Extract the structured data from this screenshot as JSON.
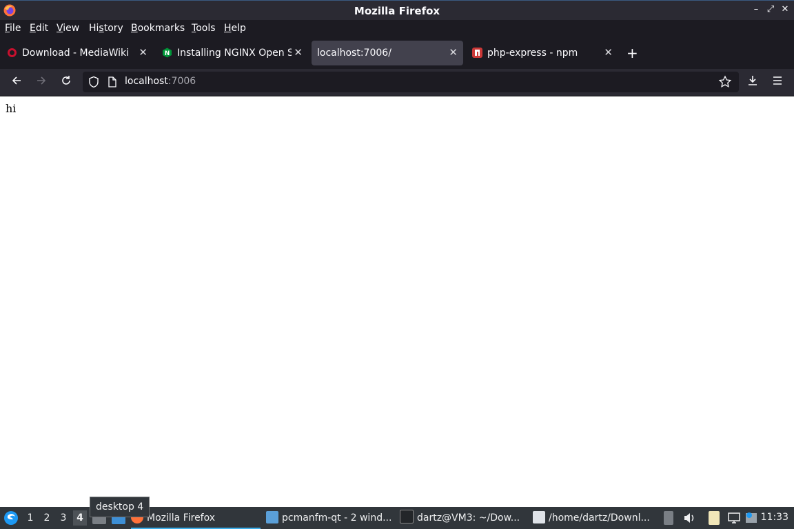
{
  "window": {
    "title": "Mozilla Firefox"
  },
  "menu": [
    {
      "label": "File",
      "underline": "F",
      "rest": "ile"
    },
    {
      "label": "Edit",
      "underline": "E",
      "rest": "dit"
    },
    {
      "label": "View",
      "underline": "V",
      "rest": "iew"
    },
    {
      "label": "History",
      "pre": "Hi",
      "underline": "s",
      "rest": "tory"
    },
    {
      "label": "Bookmarks",
      "underline": "B",
      "rest": "ookmarks"
    },
    {
      "label": "Tools",
      "underline": "T",
      "rest": "ools"
    },
    {
      "label": "Help",
      "underline": "H",
      "rest": "elp"
    }
  ],
  "tabs": [
    {
      "label": "Download - MediaWiki",
      "icon": "mediawiki-icon",
      "color": "#c8102e",
      "active": false
    },
    {
      "label": "Installing NGINX Open Sc",
      "icon": "nginx-icon",
      "color": "#009639",
      "active": false
    },
    {
      "label": "localhost:7006/",
      "icon": "",
      "color": "",
      "active": true
    },
    {
      "label": "php-express - npm",
      "icon": "npm-icon",
      "color": "#cb3837",
      "active": false
    }
  ],
  "urlbar": {
    "host_main": "localhost",
    "host_port": ":7006"
  },
  "page": {
    "text": "hi"
  },
  "tooltip": "desktop 4",
  "taskbar": {
    "desktops": [
      "1",
      "2",
      "3",
      "4"
    ],
    "active_desktop": "4",
    "tasks": [
      {
        "label": "Mozilla Firefox",
        "icon": "firefox-icon",
        "active": true
      },
      {
        "label": "pcmanfm-qt - 2 wind...",
        "icon": "folder-icon",
        "active": false
      },
      {
        "label": "dartz@VM3: ~/Dow...",
        "icon": "terminal-icon",
        "active": false
      },
      {
        "label": "/home/dartz/Downl...",
        "icon": "editor-icon",
        "active": false
      }
    ],
    "clock": "11:33"
  },
  "colors": {
    "accent": "#3daee9",
    "ff_orange": "#ff7139",
    "ff_purple": "#7542e5"
  }
}
